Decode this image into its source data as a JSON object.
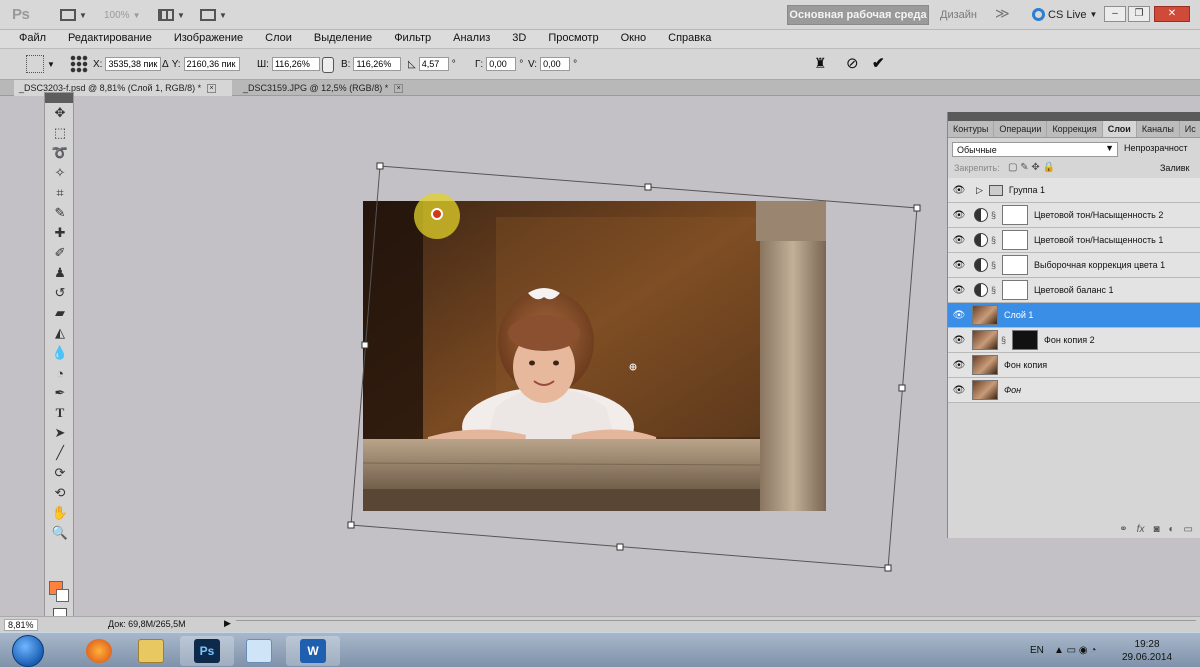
{
  "app": {
    "logo": "Ps",
    "zoom_dropdown": "100%",
    "workspace_active": "Основная рабочая среда",
    "workspace_design": "Дизайн",
    "workspace_more": "≫",
    "cs_live": "CS Live"
  },
  "menu": [
    "Файл",
    "Редактирование",
    "Изображение",
    "Слои",
    "Выделение",
    "Фильтр",
    "Анализ",
    "3D",
    "Просмотр",
    "Окно",
    "Справка"
  ],
  "options": {
    "x_label": "X:",
    "x_value": "3535,38 пик",
    "y_label": "Y:",
    "y_value": "2160,36 пик",
    "w_label": "Ш:",
    "w_value": "116,26%",
    "h_label": "В:",
    "h_value": "116,26%",
    "angle_value": "4,57",
    "angle_unit": "°",
    "hskew_label": "Г:",
    "hskew_value": "0,00",
    "vskew_label": "V:",
    "vskew_value": "0,00",
    "delta": "Δ"
  },
  "doc_tabs": [
    {
      "label": "_DSC3203-f.psd @ 8,81% (Слой 1, RGB/8) *",
      "active": true
    },
    {
      "label": "_DSC3159.JPG @ 12,5% (RGB/8) *",
      "active": false
    }
  ],
  "layers_panel": {
    "tabs": [
      "Контуры",
      "Операции",
      "Коррекция",
      "Слои",
      "Каналы",
      "Ис"
    ],
    "active_tab": "Слои",
    "blend_mode": "Обычные",
    "opacity_label": "Непрозрачност",
    "lock_label": "Закрепить:",
    "fill_label": "Заливк",
    "layers": [
      {
        "name": "Группа 1",
        "kind": "group"
      },
      {
        "name": "Цветовой тон/Насыщенность 2",
        "kind": "adjustment"
      },
      {
        "name": "Цветовой тон/Насыщенность 1",
        "kind": "adjustment"
      },
      {
        "name": "Выборочная коррекция цвета 1",
        "kind": "adjustment"
      },
      {
        "name": "Цветовой баланс 1",
        "kind": "adjustment"
      },
      {
        "name": "Слой 1",
        "kind": "pixel",
        "selected": true
      },
      {
        "name": "Фон копия 2",
        "kind": "pixel-mask"
      },
      {
        "name": "Фон копия",
        "kind": "pixel"
      },
      {
        "name": "Фон",
        "kind": "pixel"
      }
    ]
  },
  "status": {
    "zoom": "8,81%",
    "doc_size": "Док: 69,8M/265,5M"
  },
  "taskbar": {
    "lang": "EN",
    "time": "19:28",
    "date": "29.06.2014",
    "apps": [
      "firefox-icon",
      "explorer-icon",
      "photoshop-icon",
      "notes-icon",
      "word-icon"
    ]
  },
  "colors": {
    "foreground": "#ff8040",
    "background": "#ffffff",
    "selected_layer": "#3a8ee6",
    "canvas": "#c3c1c6"
  }
}
